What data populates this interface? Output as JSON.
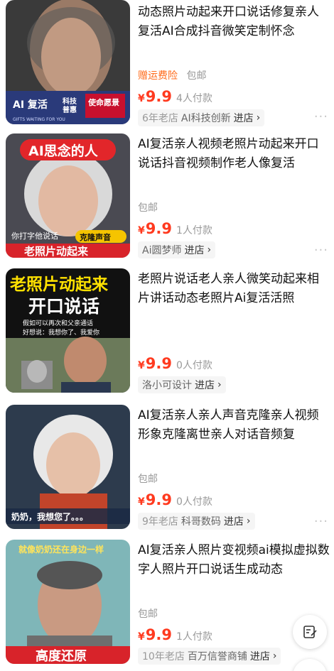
{
  "items": [
    {
      "title": "动态照片动起来开口说话修复亲人复活AI合成抖音微笑定制怀念",
      "tag_orange": "赠运费险",
      "tag_gray": "包邮",
      "currency": "¥",
      "price": "9.9",
      "sold": "4人付款",
      "shop_prefix": "6年老店",
      "shop_name": "AI科技创新",
      "enter": "进店",
      "thumb": {
        "caption_a": "AI 复活",
        "caption_b": "科技",
        "caption_c": "普惠",
        "badge": "使命愿景",
        "footer": "GIFTS WAITING FOR YOU"
      }
    },
    {
      "title": "AI复活亲人视频老照片动起来开口说话抖音视频制作老人像复活",
      "tag_orange": "",
      "tag_gray": "包邮",
      "currency": "¥",
      "price": "9.9",
      "sold": "1人付款",
      "shop_prefix": "",
      "shop_name": "Ai圆梦师",
      "enter": "进店",
      "thumb": {
        "top": "AI思念的人",
        "left_small": "你打字他说话",
        "right_small": "克隆声音",
        "bottom": "老照片动起来"
      }
    },
    {
      "title": "老照片说话老人亲人微笑动起来相片讲话动态老照片Ai复活活照",
      "tag_orange": "",
      "tag_gray": "",
      "currency": "¥",
      "price": "9.9",
      "sold": "0人付款",
      "shop_prefix": "",
      "shop_name": "洛小可设计",
      "enter": "进店",
      "thumb": {
        "line1": "老照片动起来",
        "line2": "开口说话",
        "line3": "假如可以再次和父亲通话",
        "line4": "好想说：我想你了、我爱你"
      }
    },
    {
      "title": "AI复活亲人亲人声音克隆亲人视频形象克隆离世亲人对话音频复",
      "tag_orange": "",
      "tag_gray": "包邮",
      "currency": "¥",
      "price": "9.9",
      "sold": "0人付款",
      "shop_prefix": "9年老店",
      "shop_name": "科哥数码",
      "enter": "进店",
      "thumb": {
        "caption": "奶奶，我想您了。。。"
      }
    },
    {
      "title": "AI复活亲人照片变视频ai模拟虚拟数字人照片开口说话生成动态",
      "tag_orange": "",
      "tag_gray": "包邮",
      "currency": "¥",
      "price": "9.9",
      "sold": "1人付款",
      "shop_prefix": "10年老店",
      "shop_name": "百万信誉商铺",
      "enter": "进店",
      "thumb": {
        "top": "就像奶奶还在身边一样",
        "bottom": "高度还原"
      }
    }
  ],
  "icons": {
    "more": "more-dots-icon",
    "chevron": "chevron-right-icon",
    "feedback": "edit-note-icon"
  },
  "colors": {
    "price": "#ff3a1f",
    "tag_orange": "#ff6a1a",
    "meta_gray": "#999999"
  }
}
